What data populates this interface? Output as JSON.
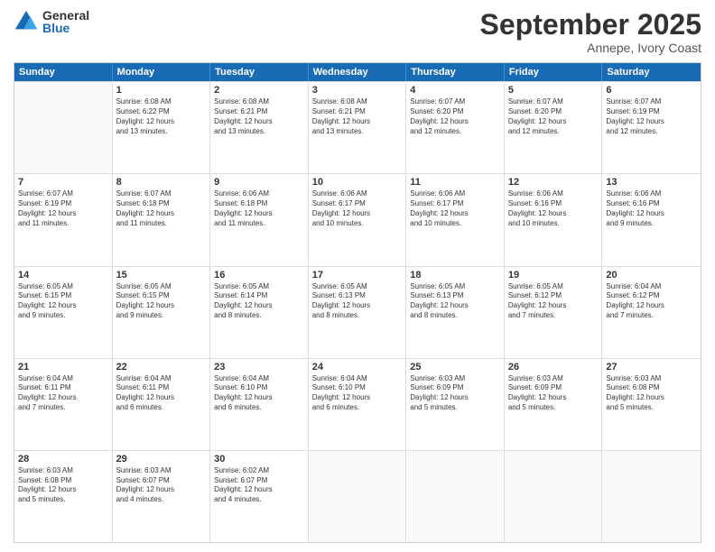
{
  "logo": {
    "general": "General",
    "blue": "Blue"
  },
  "header": {
    "month": "September 2025",
    "location": "Annepe, Ivory Coast"
  },
  "days": [
    "Sunday",
    "Monday",
    "Tuesday",
    "Wednesday",
    "Thursday",
    "Friday",
    "Saturday"
  ],
  "weeks": [
    [
      {
        "day": "",
        "lines": []
      },
      {
        "day": "1",
        "lines": [
          "Sunrise: 6:08 AM",
          "Sunset: 6:22 PM",
          "Daylight: 12 hours",
          "and 13 minutes."
        ]
      },
      {
        "day": "2",
        "lines": [
          "Sunrise: 6:08 AM",
          "Sunset: 6:21 PM",
          "Daylight: 12 hours",
          "and 13 minutes."
        ]
      },
      {
        "day": "3",
        "lines": [
          "Sunrise: 6:08 AM",
          "Sunset: 6:21 PM",
          "Daylight: 12 hours",
          "and 13 minutes."
        ]
      },
      {
        "day": "4",
        "lines": [
          "Sunrise: 6:07 AM",
          "Sunset: 6:20 PM",
          "Daylight: 12 hours",
          "and 12 minutes."
        ]
      },
      {
        "day": "5",
        "lines": [
          "Sunrise: 6:07 AM",
          "Sunset: 6:20 PM",
          "Daylight: 12 hours",
          "and 12 minutes."
        ]
      },
      {
        "day": "6",
        "lines": [
          "Sunrise: 6:07 AM",
          "Sunset: 6:19 PM",
          "Daylight: 12 hours",
          "and 12 minutes."
        ]
      }
    ],
    [
      {
        "day": "7",
        "lines": [
          "Sunrise: 6:07 AM",
          "Sunset: 6:19 PM",
          "Daylight: 12 hours",
          "and 11 minutes."
        ]
      },
      {
        "day": "8",
        "lines": [
          "Sunrise: 6:07 AM",
          "Sunset: 6:18 PM",
          "Daylight: 12 hours",
          "and 11 minutes."
        ]
      },
      {
        "day": "9",
        "lines": [
          "Sunrise: 6:06 AM",
          "Sunset: 6:18 PM",
          "Daylight: 12 hours",
          "and 11 minutes."
        ]
      },
      {
        "day": "10",
        "lines": [
          "Sunrise: 6:06 AM",
          "Sunset: 6:17 PM",
          "Daylight: 12 hours",
          "and 10 minutes."
        ]
      },
      {
        "day": "11",
        "lines": [
          "Sunrise: 6:06 AM",
          "Sunset: 6:17 PM",
          "Daylight: 12 hours",
          "and 10 minutes."
        ]
      },
      {
        "day": "12",
        "lines": [
          "Sunrise: 6:06 AM",
          "Sunset: 6:16 PM",
          "Daylight: 12 hours",
          "and 10 minutes."
        ]
      },
      {
        "day": "13",
        "lines": [
          "Sunrise: 6:06 AM",
          "Sunset: 6:16 PM",
          "Daylight: 12 hours",
          "and 9 minutes."
        ]
      }
    ],
    [
      {
        "day": "14",
        "lines": [
          "Sunrise: 6:05 AM",
          "Sunset: 6:15 PM",
          "Daylight: 12 hours",
          "and 9 minutes."
        ]
      },
      {
        "day": "15",
        "lines": [
          "Sunrise: 6:05 AM",
          "Sunset: 6:15 PM",
          "Daylight: 12 hours",
          "and 9 minutes."
        ]
      },
      {
        "day": "16",
        "lines": [
          "Sunrise: 6:05 AM",
          "Sunset: 6:14 PM",
          "Daylight: 12 hours",
          "and 8 minutes."
        ]
      },
      {
        "day": "17",
        "lines": [
          "Sunrise: 6:05 AM",
          "Sunset: 6:13 PM",
          "Daylight: 12 hours",
          "and 8 minutes."
        ]
      },
      {
        "day": "18",
        "lines": [
          "Sunrise: 6:05 AM",
          "Sunset: 6:13 PM",
          "Daylight: 12 hours",
          "and 8 minutes."
        ]
      },
      {
        "day": "19",
        "lines": [
          "Sunrise: 6:05 AM",
          "Sunset: 6:12 PM",
          "Daylight: 12 hours",
          "and 7 minutes."
        ]
      },
      {
        "day": "20",
        "lines": [
          "Sunrise: 6:04 AM",
          "Sunset: 6:12 PM",
          "Daylight: 12 hours",
          "and 7 minutes."
        ]
      }
    ],
    [
      {
        "day": "21",
        "lines": [
          "Sunrise: 6:04 AM",
          "Sunset: 6:11 PM",
          "Daylight: 12 hours",
          "and 7 minutes."
        ]
      },
      {
        "day": "22",
        "lines": [
          "Sunrise: 6:04 AM",
          "Sunset: 6:11 PM",
          "Daylight: 12 hours",
          "and 6 minutes."
        ]
      },
      {
        "day": "23",
        "lines": [
          "Sunrise: 6:04 AM",
          "Sunset: 6:10 PM",
          "Daylight: 12 hours",
          "and 6 minutes."
        ]
      },
      {
        "day": "24",
        "lines": [
          "Sunrise: 6:04 AM",
          "Sunset: 6:10 PM",
          "Daylight: 12 hours",
          "and 6 minutes."
        ]
      },
      {
        "day": "25",
        "lines": [
          "Sunrise: 6:03 AM",
          "Sunset: 6:09 PM",
          "Daylight: 12 hours",
          "and 5 minutes."
        ]
      },
      {
        "day": "26",
        "lines": [
          "Sunrise: 6:03 AM",
          "Sunset: 6:09 PM",
          "Daylight: 12 hours",
          "and 5 minutes."
        ]
      },
      {
        "day": "27",
        "lines": [
          "Sunrise: 6:03 AM",
          "Sunset: 6:08 PM",
          "Daylight: 12 hours",
          "and 5 minutes."
        ]
      }
    ],
    [
      {
        "day": "28",
        "lines": [
          "Sunrise: 6:03 AM",
          "Sunset: 6:08 PM",
          "Daylight: 12 hours",
          "and 5 minutes."
        ]
      },
      {
        "day": "29",
        "lines": [
          "Sunrise: 6:03 AM",
          "Sunset: 6:07 PM",
          "Daylight: 12 hours",
          "and 4 minutes."
        ]
      },
      {
        "day": "30",
        "lines": [
          "Sunrise: 6:02 AM",
          "Sunset: 6:07 PM",
          "Daylight: 12 hours",
          "and 4 minutes."
        ]
      },
      {
        "day": "",
        "lines": []
      },
      {
        "day": "",
        "lines": []
      },
      {
        "day": "",
        "lines": []
      },
      {
        "day": "",
        "lines": []
      }
    ]
  ]
}
